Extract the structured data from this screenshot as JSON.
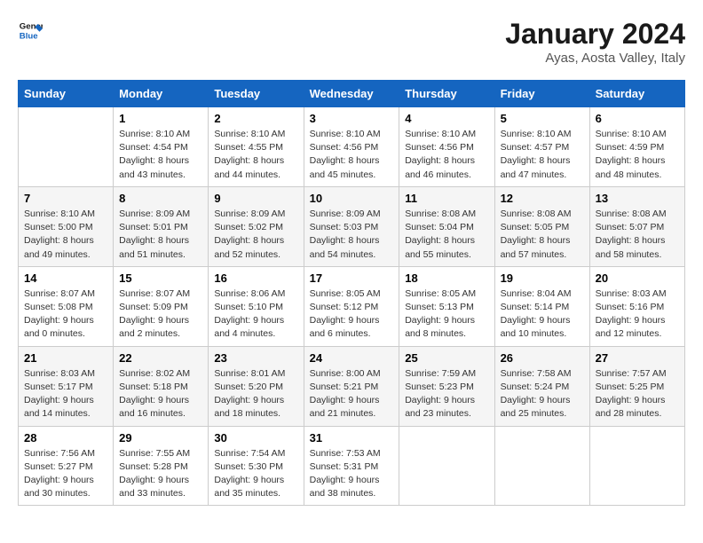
{
  "header": {
    "logo": {
      "general": "General",
      "blue": "Blue"
    },
    "title": "January 2024",
    "location": "Ayas, Aosta Valley, Italy"
  },
  "days_of_week": [
    "Sunday",
    "Monday",
    "Tuesday",
    "Wednesday",
    "Thursday",
    "Friday",
    "Saturday"
  ],
  "weeks": [
    [
      {
        "num": "",
        "info": ""
      },
      {
        "num": "1",
        "info": "Sunrise: 8:10 AM\nSunset: 4:54 PM\nDaylight: 8 hours\nand 43 minutes."
      },
      {
        "num": "2",
        "info": "Sunrise: 8:10 AM\nSunset: 4:55 PM\nDaylight: 8 hours\nand 44 minutes."
      },
      {
        "num": "3",
        "info": "Sunrise: 8:10 AM\nSunset: 4:56 PM\nDaylight: 8 hours\nand 45 minutes."
      },
      {
        "num": "4",
        "info": "Sunrise: 8:10 AM\nSunset: 4:56 PM\nDaylight: 8 hours\nand 46 minutes."
      },
      {
        "num": "5",
        "info": "Sunrise: 8:10 AM\nSunset: 4:57 PM\nDaylight: 8 hours\nand 47 minutes."
      },
      {
        "num": "6",
        "info": "Sunrise: 8:10 AM\nSunset: 4:59 PM\nDaylight: 8 hours\nand 48 minutes."
      }
    ],
    [
      {
        "num": "7",
        "info": "Sunrise: 8:10 AM\nSunset: 5:00 PM\nDaylight: 8 hours\nand 49 minutes."
      },
      {
        "num": "8",
        "info": "Sunrise: 8:09 AM\nSunset: 5:01 PM\nDaylight: 8 hours\nand 51 minutes."
      },
      {
        "num": "9",
        "info": "Sunrise: 8:09 AM\nSunset: 5:02 PM\nDaylight: 8 hours\nand 52 minutes."
      },
      {
        "num": "10",
        "info": "Sunrise: 8:09 AM\nSunset: 5:03 PM\nDaylight: 8 hours\nand 54 minutes."
      },
      {
        "num": "11",
        "info": "Sunrise: 8:08 AM\nSunset: 5:04 PM\nDaylight: 8 hours\nand 55 minutes."
      },
      {
        "num": "12",
        "info": "Sunrise: 8:08 AM\nSunset: 5:05 PM\nDaylight: 8 hours\nand 57 minutes."
      },
      {
        "num": "13",
        "info": "Sunrise: 8:08 AM\nSunset: 5:07 PM\nDaylight: 8 hours\nand 58 minutes."
      }
    ],
    [
      {
        "num": "14",
        "info": "Sunrise: 8:07 AM\nSunset: 5:08 PM\nDaylight: 9 hours\nand 0 minutes."
      },
      {
        "num": "15",
        "info": "Sunrise: 8:07 AM\nSunset: 5:09 PM\nDaylight: 9 hours\nand 2 minutes."
      },
      {
        "num": "16",
        "info": "Sunrise: 8:06 AM\nSunset: 5:10 PM\nDaylight: 9 hours\nand 4 minutes."
      },
      {
        "num": "17",
        "info": "Sunrise: 8:05 AM\nSunset: 5:12 PM\nDaylight: 9 hours\nand 6 minutes."
      },
      {
        "num": "18",
        "info": "Sunrise: 8:05 AM\nSunset: 5:13 PM\nDaylight: 9 hours\nand 8 minutes."
      },
      {
        "num": "19",
        "info": "Sunrise: 8:04 AM\nSunset: 5:14 PM\nDaylight: 9 hours\nand 10 minutes."
      },
      {
        "num": "20",
        "info": "Sunrise: 8:03 AM\nSunset: 5:16 PM\nDaylight: 9 hours\nand 12 minutes."
      }
    ],
    [
      {
        "num": "21",
        "info": "Sunrise: 8:03 AM\nSunset: 5:17 PM\nDaylight: 9 hours\nand 14 minutes."
      },
      {
        "num": "22",
        "info": "Sunrise: 8:02 AM\nSunset: 5:18 PM\nDaylight: 9 hours\nand 16 minutes."
      },
      {
        "num": "23",
        "info": "Sunrise: 8:01 AM\nSunset: 5:20 PM\nDaylight: 9 hours\nand 18 minutes."
      },
      {
        "num": "24",
        "info": "Sunrise: 8:00 AM\nSunset: 5:21 PM\nDaylight: 9 hours\nand 21 minutes."
      },
      {
        "num": "25",
        "info": "Sunrise: 7:59 AM\nSunset: 5:23 PM\nDaylight: 9 hours\nand 23 minutes."
      },
      {
        "num": "26",
        "info": "Sunrise: 7:58 AM\nSunset: 5:24 PM\nDaylight: 9 hours\nand 25 minutes."
      },
      {
        "num": "27",
        "info": "Sunrise: 7:57 AM\nSunset: 5:25 PM\nDaylight: 9 hours\nand 28 minutes."
      }
    ],
    [
      {
        "num": "28",
        "info": "Sunrise: 7:56 AM\nSunset: 5:27 PM\nDaylight: 9 hours\nand 30 minutes."
      },
      {
        "num": "29",
        "info": "Sunrise: 7:55 AM\nSunset: 5:28 PM\nDaylight: 9 hours\nand 33 minutes."
      },
      {
        "num": "30",
        "info": "Sunrise: 7:54 AM\nSunset: 5:30 PM\nDaylight: 9 hours\nand 35 minutes."
      },
      {
        "num": "31",
        "info": "Sunrise: 7:53 AM\nSunset: 5:31 PM\nDaylight: 9 hours\nand 38 minutes."
      },
      {
        "num": "",
        "info": ""
      },
      {
        "num": "",
        "info": ""
      },
      {
        "num": "",
        "info": ""
      }
    ]
  ]
}
